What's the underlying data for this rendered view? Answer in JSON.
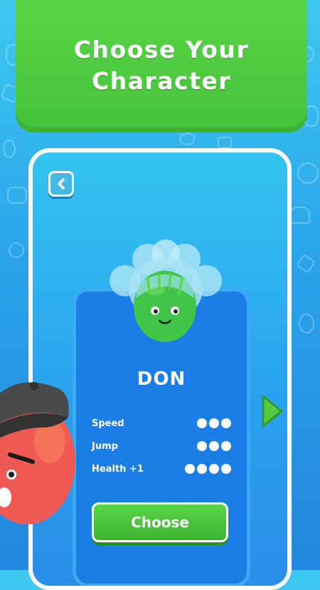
{
  "header": {
    "title": "Choose Your\nCharacter"
  },
  "character": {
    "name": "DON",
    "stats": [
      {
        "label": "Speed",
        "dots": 3
      },
      {
        "label": "Jump",
        "dots": 3
      },
      {
        "label": "Health +1",
        "dots": 4
      }
    ]
  },
  "actions": {
    "choose_label": "Choose"
  },
  "icons": {
    "back": "chevron-left-icon",
    "next": "triangle-right-icon"
  },
  "colors": {
    "banner_green": "#4ccb3f",
    "card_blue": "#1b7ee6",
    "background_blue": "#2aa4ea"
  }
}
